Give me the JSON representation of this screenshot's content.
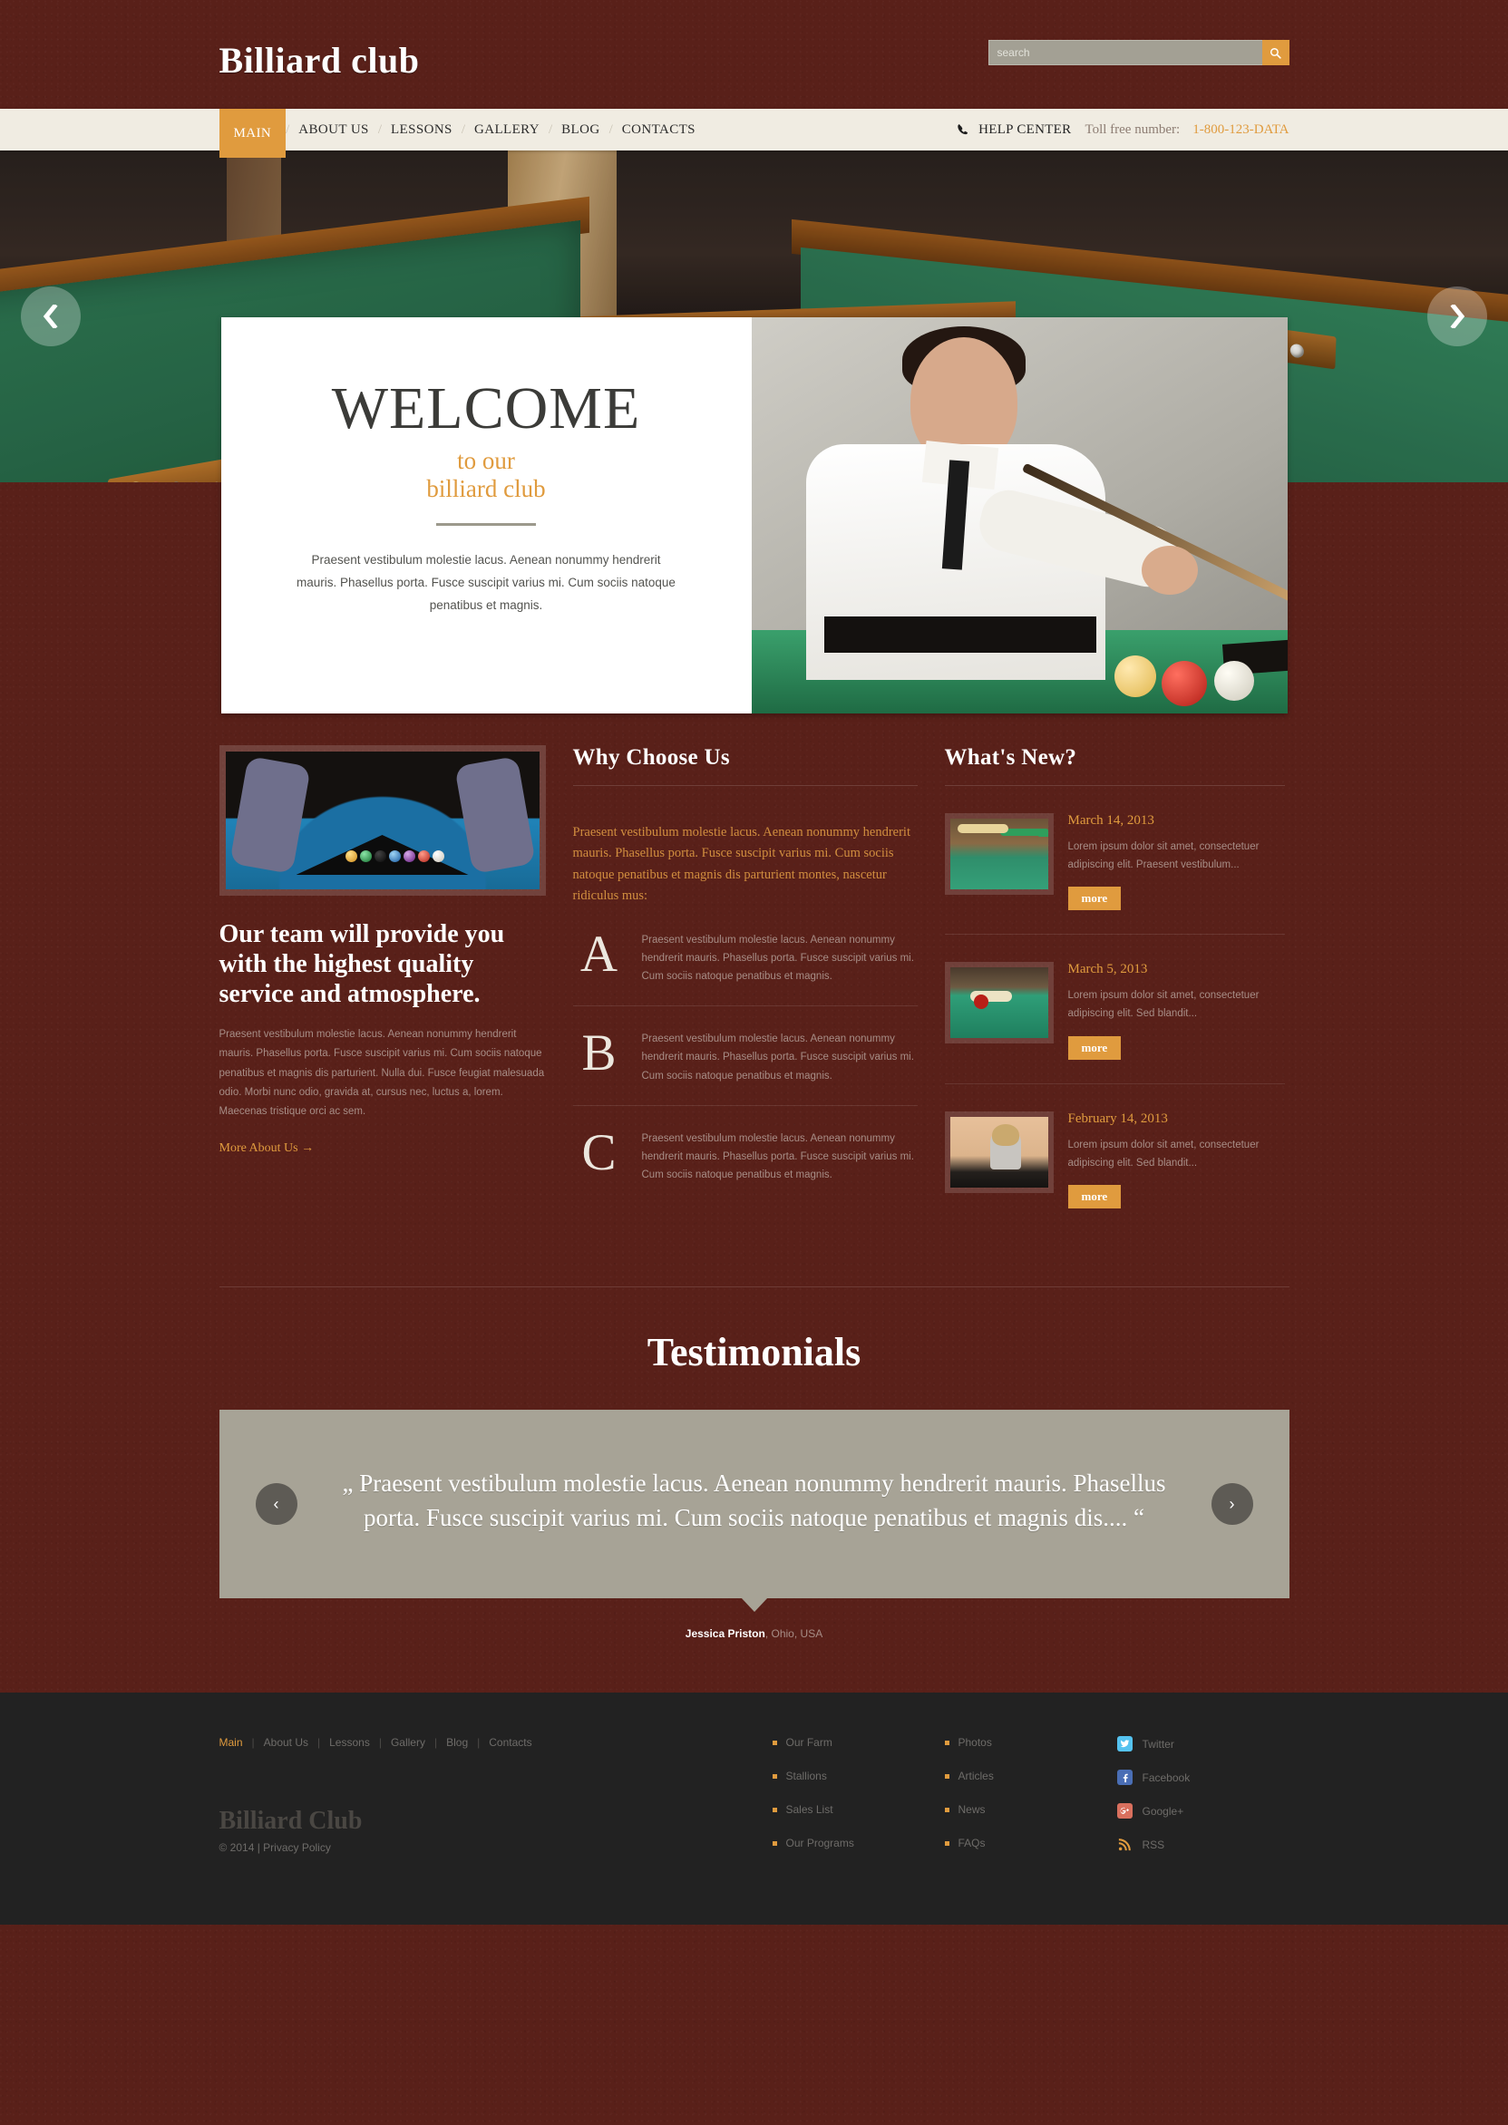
{
  "header": {
    "logo": "Billiard club",
    "search": {
      "placeholder": "search",
      "value": "",
      "button_icon": "search-icon"
    }
  },
  "nav": {
    "items": [
      {
        "label": "MAIN",
        "active": true
      },
      {
        "label": "ABOUT US",
        "active": false
      },
      {
        "label": "LESSONS",
        "active": false
      },
      {
        "label": "GALLERY",
        "active": false
      },
      {
        "label": "BLOG",
        "active": false
      },
      {
        "label": "CONTACTS",
        "active": false
      }
    ],
    "separator": "/",
    "help": {
      "icon": "phone-icon",
      "title": "HELP CENTER",
      "label": "Toll free number:",
      "number": "1-800-123-DATA"
    }
  },
  "slider": {
    "prev_icon": "chevron-left-icon",
    "next_icon": "chevron-right-icon"
  },
  "welcome": {
    "title": "WELCOME",
    "subtitle_line1": "to our",
    "subtitle_line2": "billiard club",
    "text": "Praesent vestibulum molestie lacus. Aenean nonummy hendrerit mauris. Phasellus porta. Fusce suscipit varius mi. Cum sociis natoque penatibus et magnis."
  },
  "team": {
    "image_alt": "hands-racking-billiard-balls",
    "heading": "Our team will provide you with the highest quality service and atmosphere.",
    "body": "Praesent vestibulum molestie lacus. Aenean nonummy hendrerit mauris. Phasellus porta. Fusce suscipit varius mi. Cum sociis natoque penatibus et magnis dis parturient. Nulla dui. Fusce feugiat malesuada odio. Morbi nunc odio, gravida at, cursus nec, luctus a, lorem. Maecenas tristique orci ac sem.",
    "link": "More About Us →"
  },
  "why": {
    "title": "Why Choose Us",
    "intro": "Praesent vestibulum molestie lacus. Aenean nonummy hendrerit mauris. Phasellus porta. Fusce suscipit varius mi. Cum sociis natoque penatibus et magnis dis parturient montes, nascetur ridiculus mus:",
    "items": [
      {
        "letter": "A",
        "text": "Praesent vestibulum molestie lacus. Aenean nonummy hendrerit mauris. Phasellus porta. Fusce suscipit varius mi. Cum sociis natoque penatibus et magnis."
      },
      {
        "letter": "B",
        "text": "Praesent vestibulum molestie lacus. Aenean nonummy hendrerit mauris. Phasellus porta. Fusce suscipit varius mi. Cum sociis natoque penatibus et magnis."
      },
      {
        "letter": "C",
        "text": "Praesent vestibulum molestie lacus. Aenean nonummy hendrerit mauris. Phasellus porta. Fusce suscipit varius mi. Cum sociis natoque penatibus et magnis."
      }
    ]
  },
  "news": {
    "title": "What's New?",
    "items": [
      {
        "date": "March 14, 2013",
        "text": "Lorem ipsum dolor sit amet, consectetuer adipiscing elit. Praesent vestibulum...",
        "button": "more",
        "image_alt": "billiard-hall-with-green-lamps"
      },
      {
        "date": "March 5, 2013",
        "text": "Lorem ipsum dolor sit amet, consectetuer adipiscing elit. Sed blandit...",
        "button": "more",
        "image_alt": "hand-with-cue-and-red-ball"
      },
      {
        "date": "February 14, 2013",
        "text": "Lorem ipsum dolor sit amet, consectetuer adipiscing elit. Sed blandit...",
        "button": "more",
        "image_alt": "woman-aiming-cue"
      }
    ]
  },
  "testimonials": {
    "title": "Testimonials",
    "quote": "„ Praesent vestibulum molestie lacus. Aenean nonummy hendrerit mauris. Phasellus porta. Fusce suscipit varius mi. Cum sociis natoque penatibus et magnis dis.... “",
    "author_name": "Jessica Priston",
    "author_location": ", Ohio, USA",
    "prev_icon": "chevron-left-icon",
    "next_icon": "chevron-right-icon"
  },
  "footer": {
    "nav": [
      {
        "label": "Main",
        "active": true
      },
      {
        "label": "About Us",
        "active": false
      },
      {
        "label": "Lessons",
        "active": false
      },
      {
        "label": "Gallery",
        "active": false
      },
      {
        "label": "Blog",
        "active": false
      },
      {
        "label": "Contacts",
        "active": false
      }
    ],
    "separator": "|",
    "brand": "Billiard Club",
    "copyright": "© 2014  |  ",
    "privacy": "Privacy Policy",
    "col1": [
      "Our Farm",
      "Stallions",
      "Sales List",
      "Our Programs"
    ],
    "col2": [
      "Photos",
      "Articles",
      "News",
      "FAQs"
    ],
    "social": [
      {
        "label": "Twitter",
        "icon": "twitter-icon"
      },
      {
        "label": "Facebook",
        "icon": "facebook-icon"
      },
      {
        "label": "Google+",
        "icon": "google-plus-icon"
      },
      {
        "label": "RSS",
        "icon": "rss-icon"
      }
    ]
  },
  "colors": {
    "accent": "#e09b3e",
    "background": "#592019",
    "nav_bg": "#f0ece2",
    "footer_bg": "#222222",
    "testimonial_bg": "#a7a396"
  }
}
